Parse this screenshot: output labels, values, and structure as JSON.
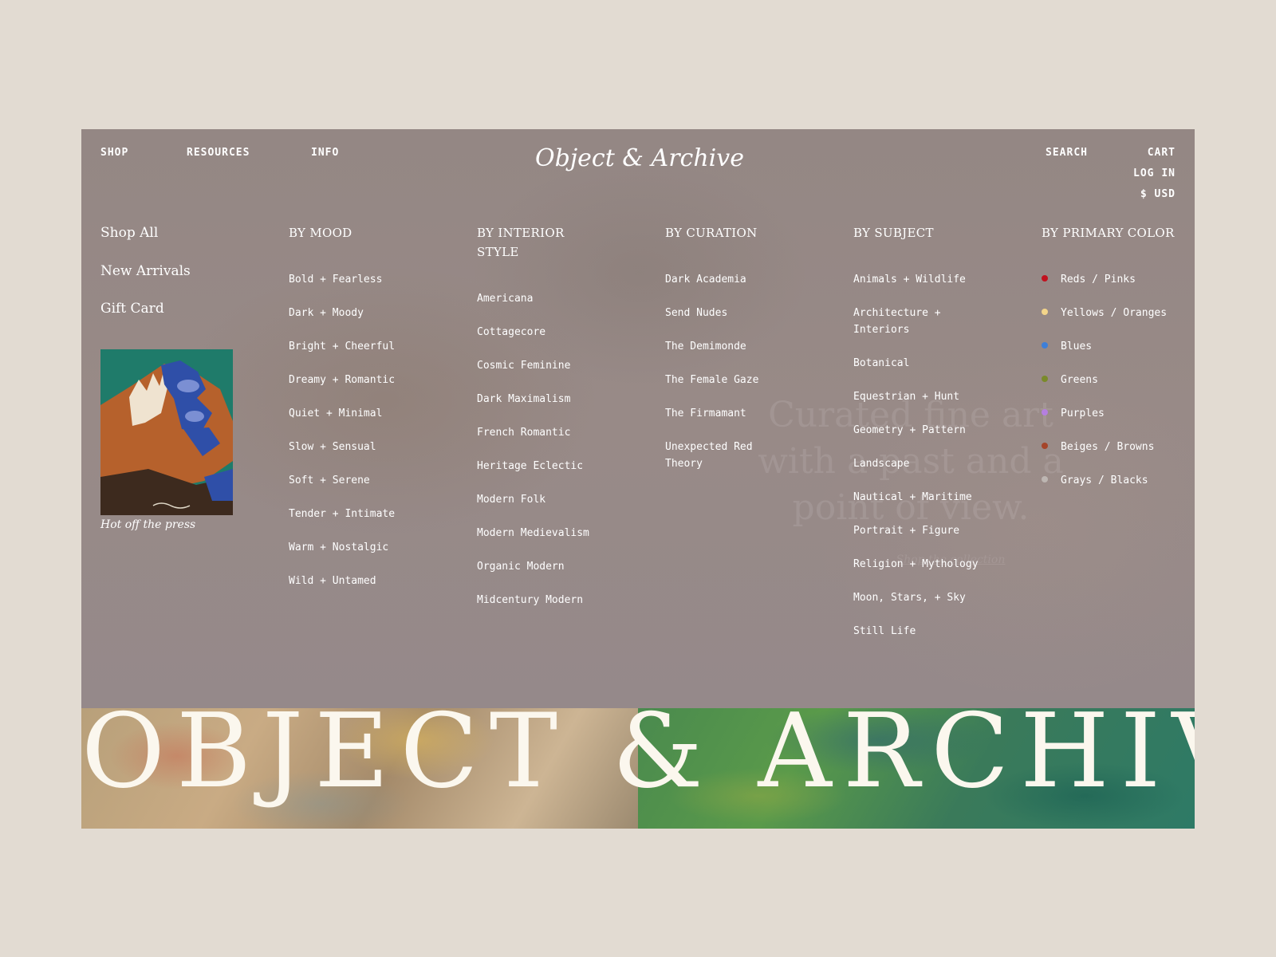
{
  "header": {
    "nav": [
      "SHOP",
      "RESOURCES",
      "INFO"
    ],
    "logo": "Object & Archive",
    "search_label": "SEARCH",
    "cart_label": "CART",
    "login_label": "LOG IN",
    "currency_label": "$ USD"
  },
  "shop_links": [
    "Shop All",
    "New Arrivals",
    "Gift Card"
  ],
  "promo": {
    "caption": "Hot off the press"
  },
  "menu": {
    "mood": {
      "heading": "BY MOOD",
      "items": [
        "Bold + Fearless",
        "Dark + Moody",
        "Bright + Cheerful",
        "Dreamy + Romantic",
        "Quiet + Minimal",
        "Slow + Sensual",
        "Soft + Serene",
        "Tender + Intimate",
        "Warm + Nostalgic",
        "Wild + Untamed"
      ]
    },
    "interior": {
      "heading": "BY INTERIOR STYLE",
      "items": [
        "Americana",
        "Cottagecore",
        "Cosmic Feminine",
        "Dark Maximalism",
        "French Romantic",
        "Heritage Eclectic",
        "Modern Folk",
        "Modern Medievalism",
        "Organic Modern",
        "Midcentury Modern"
      ]
    },
    "curation": {
      "heading": "BY CURATION",
      "items": [
        "Dark Academia",
        "Send Nudes",
        "The Demimonde",
        "The Female Gaze",
        "The Firmamant",
        "Unexpected Red Theory"
      ]
    },
    "subject": {
      "heading": "BY SUBJECT",
      "items": [
        "Animals + Wildlife",
        "Architecture + Interiors",
        "Botanical",
        "Equestrian + Hunt",
        "Geometry + Pattern",
        "Landscape",
        "Nautical + Maritime",
        "Portrait + Figure",
        "Religion + Mythology",
        "Moon, Stars, + Sky",
        "Still Life"
      ]
    },
    "color": {
      "heading": "BY PRIMARY COLOR",
      "items": [
        {
          "label": "Reds / Pinks",
          "color": "#c1121f"
        },
        {
          "label": "Yellows / Oranges",
          "color": "#f3d58a"
        },
        {
          "label": "Blues",
          "color": "#3d7fd9"
        },
        {
          "label": "Greens",
          "color": "#7a8a2a"
        },
        {
          "label": "Purples",
          "color": "#b57fe0"
        },
        {
          "label": "Beiges / Browns",
          "color": "#a5452a"
        },
        {
          "label": "Grays / Blacks",
          "color": "#bdb6b2"
        }
      ]
    }
  },
  "hero": {
    "tagline": "Curated fine art with a past and a point of view.",
    "link": "Shop the collection"
  },
  "banner": {
    "wordmark": "OBJECT & ARCHIVE"
  }
}
